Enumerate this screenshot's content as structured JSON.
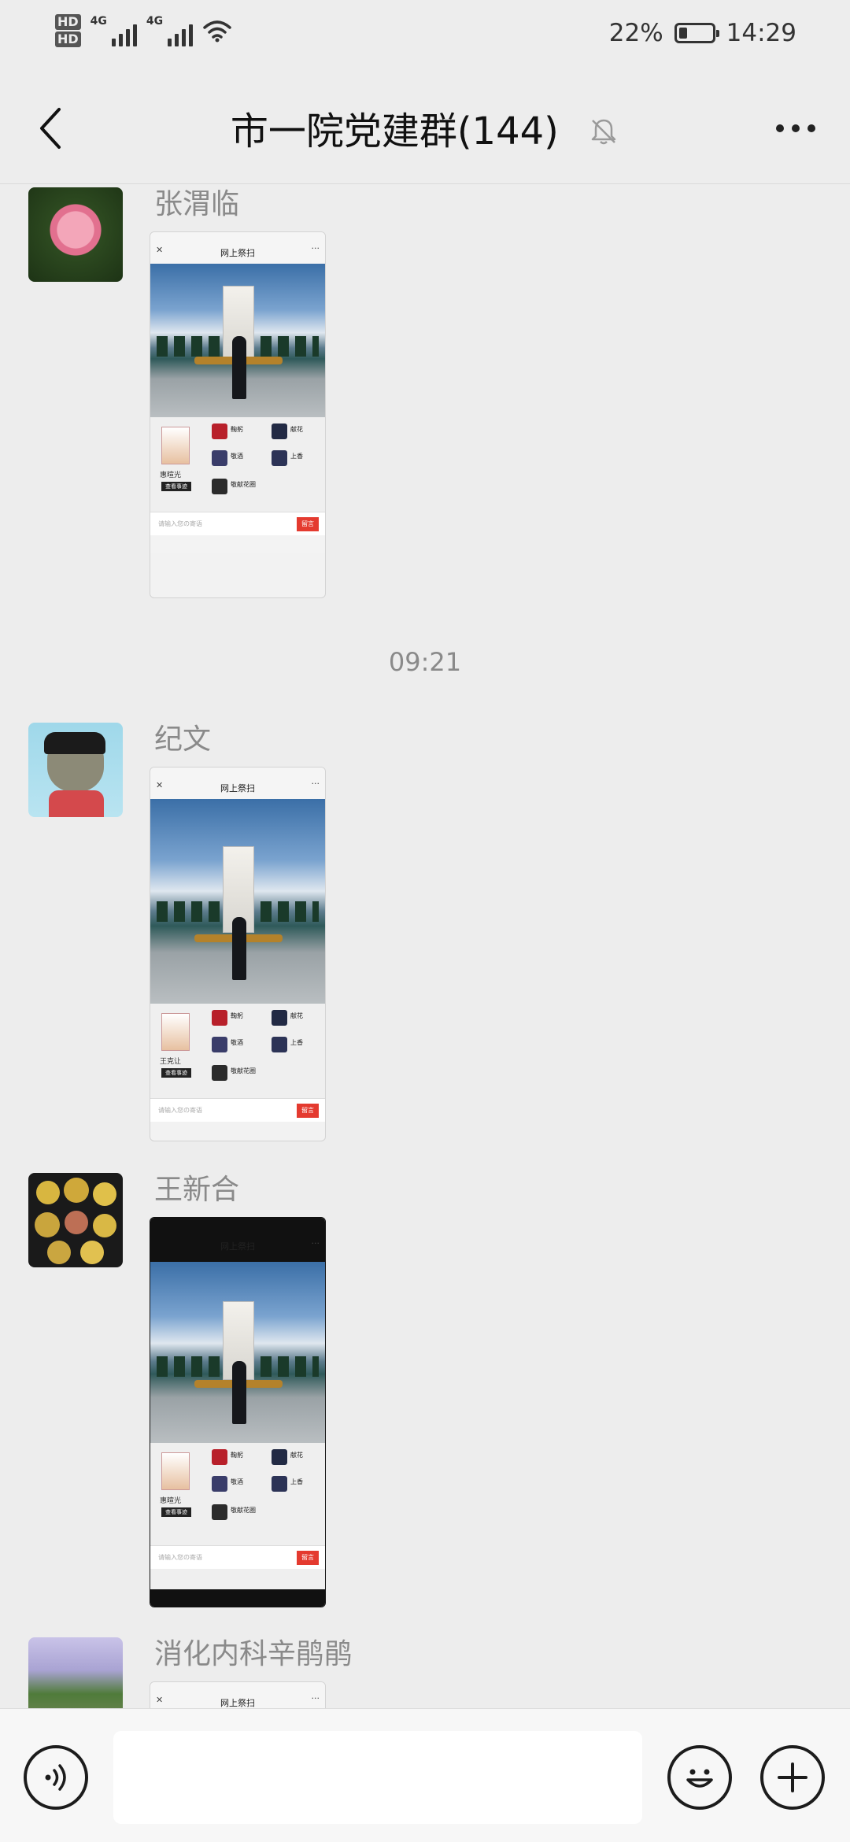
{
  "status_bar": {
    "hd1": "HD",
    "hd2": "HD",
    "net1": "4G",
    "net2": "4G",
    "battery_percent": "22%",
    "battery_level": 0.22,
    "time": "14:29"
  },
  "header": {
    "title": "市一院党建群(144)",
    "icons": [
      "back-icon",
      "mute-bell-icon",
      "more-icon"
    ]
  },
  "messages": [
    {
      "sender": "张渭临",
      "thumb": {
        "title": "网上祭扫",
        "person_name": "惠暄光",
        "detail_btn": "查看事迹",
        "items": [
          "鞠躬",
          "献花",
          "敬酒",
          "上香",
          "敬献花圈"
        ],
        "input_placeholder": "请输入您の寄语",
        "send": "留言"
      }
    },
    {
      "sender": "纪文",
      "thumb": {
        "title": "网上祭扫",
        "person_name": "王克让",
        "detail_btn": "查看事迹",
        "items": [
          "鞠躬",
          "献花",
          "敬酒",
          "上香",
          "敬献花圈"
        ],
        "input_placeholder": "请输入您の寄语",
        "send": "留言"
      }
    },
    {
      "sender": "王新合",
      "thumb": {
        "title": "网上祭扫",
        "person_name": "惠暄光",
        "detail_btn": "查看事迹",
        "items": [
          "鞠躬",
          "献花",
          "敬酒",
          "上香",
          "敬献花圈"
        ],
        "input_placeholder": "请输入您の寄语",
        "send": "留言"
      }
    },
    {
      "sender": "消化内科辛鹃鹃",
      "thumb": {
        "title": "网上祭扫"
      }
    }
  ],
  "time_divider": "09:21",
  "input_bar": {
    "icons": [
      "voice-icon",
      "emoji-icon",
      "plus-icon"
    ]
  }
}
